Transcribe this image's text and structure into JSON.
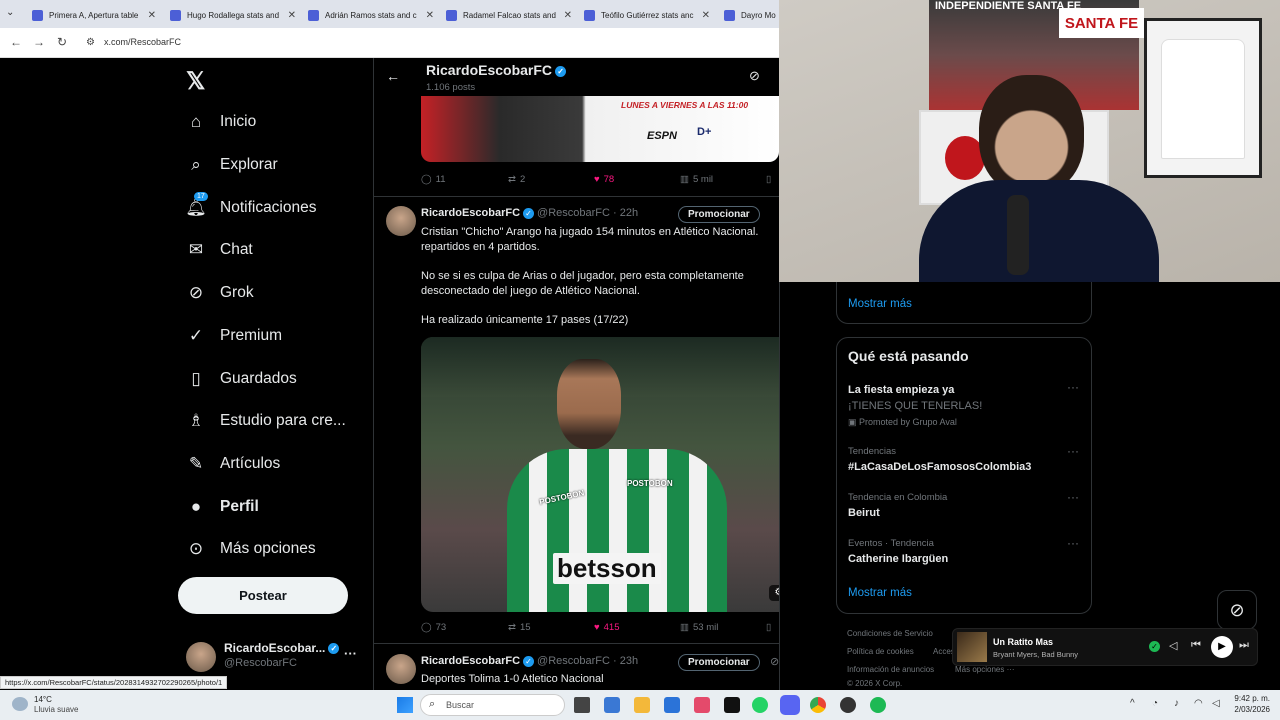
{
  "browser": {
    "tabs": [
      {
        "title": "Primera A, Apertura table"
      },
      {
        "title": "Hugo Rodallega stats and"
      },
      {
        "title": "Adrián Ramos stats and c"
      },
      {
        "title": "Radamel Falcao stats and"
      },
      {
        "title": "Teófilo Gutiérrez stats anc"
      },
      {
        "title": "Dayro Mo"
      }
    ],
    "url": "x.com/RescobarFC",
    "status_url": "https://x.com/RescobarFC/status/2028314932702290265/photo/1"
  },
  "sidebar": {
    "items": [
      {
        "label": "Inicio",
        "icon": "home-icon"
      },
      {
        "label": "Explorar",
        "icon": "search-icon"
      },
      {
        "label": "Notificaciones",
        "icon": "bell-icon",
        "badge": "17"
      },
      {
        "label": "Chat",
        "icon": "mail-icon"
      },
      {
        "label": "Grok",
        "icon": "grok-icon"
      },
      {
        "label": "Premium",
        "icon": "verified-icon"
      },
      {
        "label": "Guardados",
        "icon": "bookmark-icon"
      },
      {
        "label": "Estudio para cre...",
        "icon": "studio-icon"
      },
      {
        "label": "Artículos",
        "icon": "articles-icon"
      },
      {
        "label": "Perfil",
        "icon": "person-icon"
      },
      {
        "label": "Más opciones",
        "icon": "more-icon"
      }
    ],
    "post_label": "Postear",
    "account": {
      "name": "RicardoEscobar...",
      "handle": "@RescobarFC"
    }
  },
  "profile_header": {
    "name": "RicardoEscobarFC",
    "posts": "1.106 posts"
  },
  "prev_post": {
    "banner_text": "LUNES A VIERNES A LAS 11:00",
    "banner_brand": "ESPN",
    "replies": "11",
    "reposts": "2",
    "likes": "78",
    "views": "5 mil"
  },
  "post": {
    "author": "RicardoEscobarFC",
    "handle": "@RescobarFC",
    "time": "· 22h",
    "promote": "Promocionar",
    "text1": "Cristian \"Chicho\" Arango ha jugado 154 minutos en Atlético Nacional. repartidos en 4 partidos.",
    "text2": "No se si es culpa de Arias o del jugador, pero esta completamente desconectado del juego de Atlético Nacional.",
    "text3": "Ha realizado únicamente 17 pases  (17/22)",
    "sponsor1": "POSTOBON",
    "sponsor2": "betsson",
    "replies": "73",
    "reposts": "15",
    "likes": "415",
    "views": "53 mil"
  },
  "next_post": {
    "author": "RicardoEscobarFC",
    "handle": "@RescobarFC",
    "time": "· 23h",
    "promote": "Promocionar",
    "text": "Deportes Tolima 1-0 Atletico Nacional"
  },
  "right": {
    "show_more_top": "Mostrar más",
    "trends_title": "Qué está pasando",
    "trends": [
      {
        "context": "",
        "title": "La fiesta empieza ya",
        "sub": "¡TIENES QUE TENERLAS!",
        "promo": "Promoted by Grupo Aval"
      },
      {
        "context": "Tendencias",
        "title": "#LaCasaDeLosFamososColombia3"
      },
      {
        "context": "Tendencia en Colombia",
        "title": "Beirut"
      },
      {
        "context": "Eventos · Tendencia",
        "title": "Catherine Ibargüen"
      }
    ],
    "show_more": "Mostrar más",
    "footer": [
      "Condiciones de Servicio",
      "Política de cookies",
      "Accesibilidad",
      "Información de anuncios",
      "Más opciones ···",
      "© 2026 X Corp."
    ]
  },
  "webcam": {
    "banner_text": "INDEPENDIENTE SANTA FE",
    "banner_text2": "SANTA FE"
  },
  "player": {
    "title": "Un Ratito Mas",
    "artist": "Bryant Myers, Bad Bunny"
  },
  "taskbar": {
    "weather_temp": "14°C",
    "weather_desc": "Lluvia suave",
    "search_placeholder": "Buscar",
    "time": "9:42 p. m.",
    "date": "2/03/2026"
  },
  "colors": {
    "accent": "#1d9bf0",
    "like": "#f91880",
    "nacional_green": "#1a8a4a"
  }
}
